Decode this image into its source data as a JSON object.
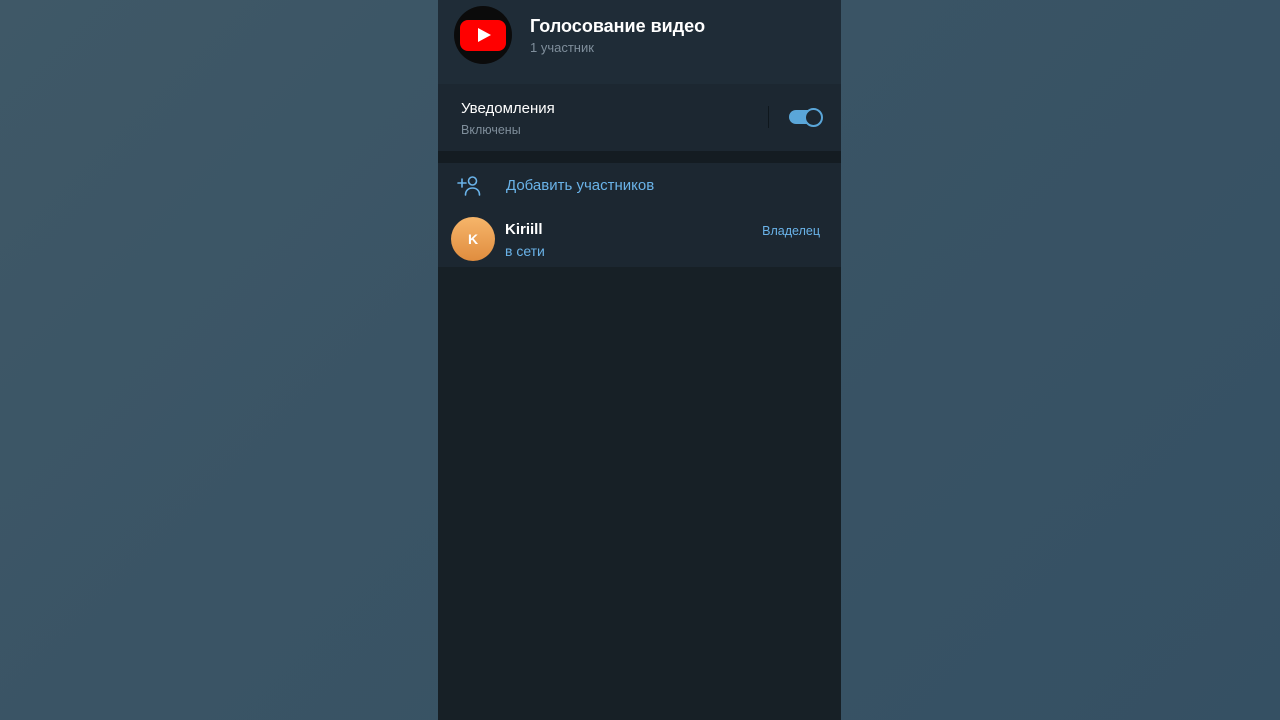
{
  "chat": {
    "title": "Голосование видео",
    "subtitle": "1 участник",
    "avatar_icon": "youtube-logo-icon"
  },
  "notifications": {
    "label": "Уведомления",
    "status": "Включены",
    "enabled": true
  },
  "members": {
    "add_label": "Добавить участников",
    "add_icon": "add-user-icon",
    "list": [
      {
        "initial": "K",
        "name": "Kiriill",
        "status": "в сети",
        "role": "Владелец"
      }
    ]
  },
  "colors": {
    "accent": "#6ab3e9",
    "toggle": "#5aa6d9",
    "panel": "#1c2731",
    "background": "#172026",
    "youtube_red": "#ff0000",
    "avatar_orange": "#f0a555"
  }
}
